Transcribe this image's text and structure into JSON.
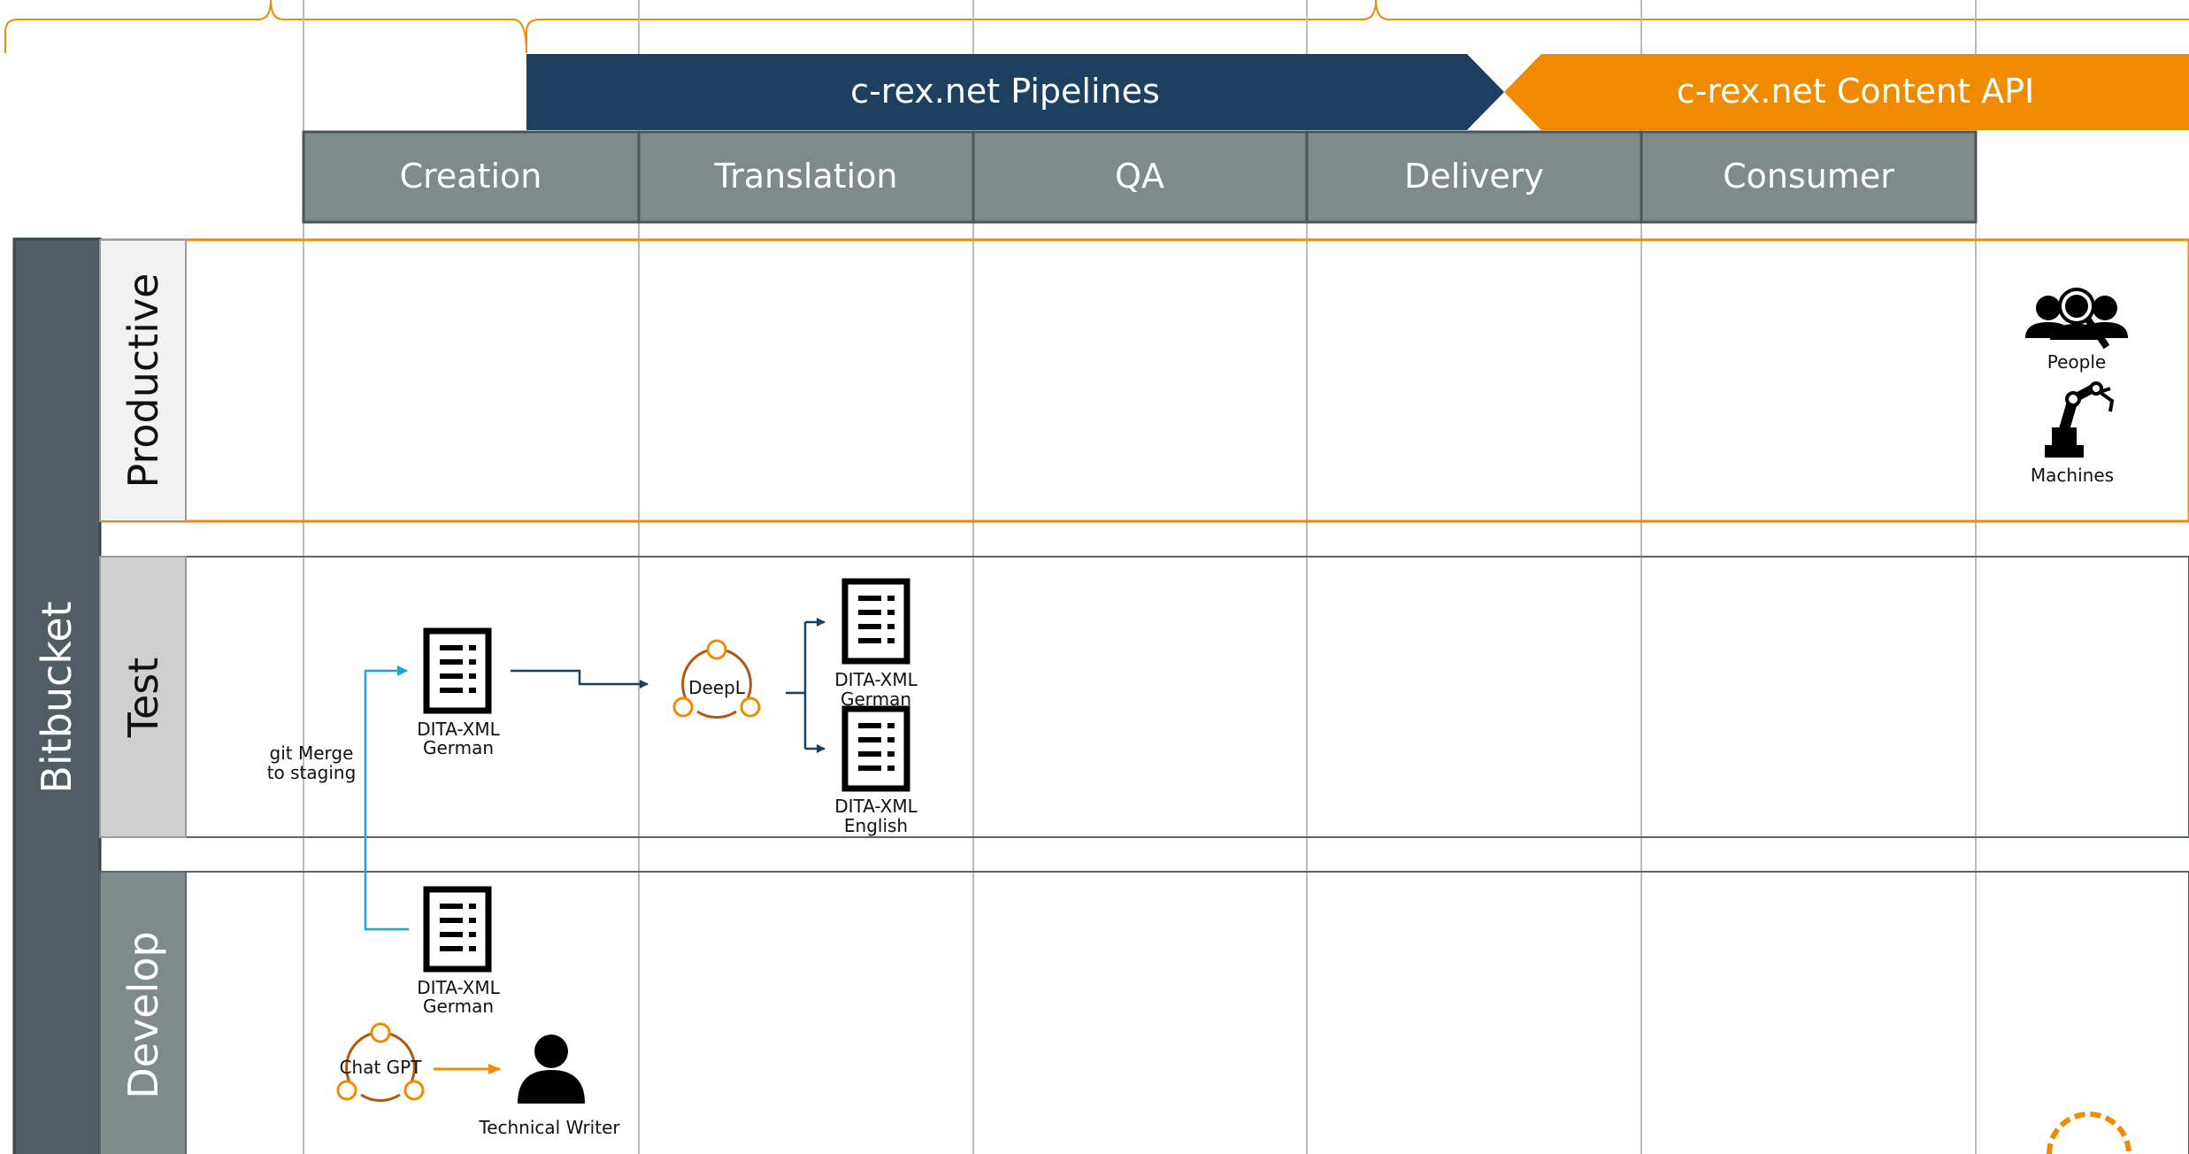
{
  "banners": {
    "pipelines": "c-rex.net Pipelines",
    "content_api": "c-rex.net Content API"
  },
  "stages": [
    "Creation",
    "Translation",
    "QA",
    "Delivery",
    "Consumer"
  ],
  "repository": "Bitbucket",
  "lanes": {
    "productive": "Productive",
    "test": "Test",
    "develop": "Develop"
  },
  "consumers": {
    "people": "People",
    "machines": "Machines"
  },
  "nodes": {
    "test_german_line1": "DITA-XML",
    "test_german_line2": "German",
    "deepl": "DeepL",
    "out_german_line1": "DITA-XML",
    "out_german_line2": "German",
    "out_english_line1": "DITA-XML",
    "out_english_line2": "English",
    "dev_german_line1": "DITA-XML",
    "dev_german_line2": "German",
    "chatgpt": "Chat GPT",
    "writer": "Technical Writer"
  },
  "merge_label": {
    "line1": "git Merge",
    "line2": "to staging"
  },
  "colors": {
    "navy": "#1e4060",
    "orange": "#f08a00",
    "gray_stage": "#7f8a8b",
    "gray_side": "#515d64",
    "cyan_arrow": "#1aa6dd"
  }
}
